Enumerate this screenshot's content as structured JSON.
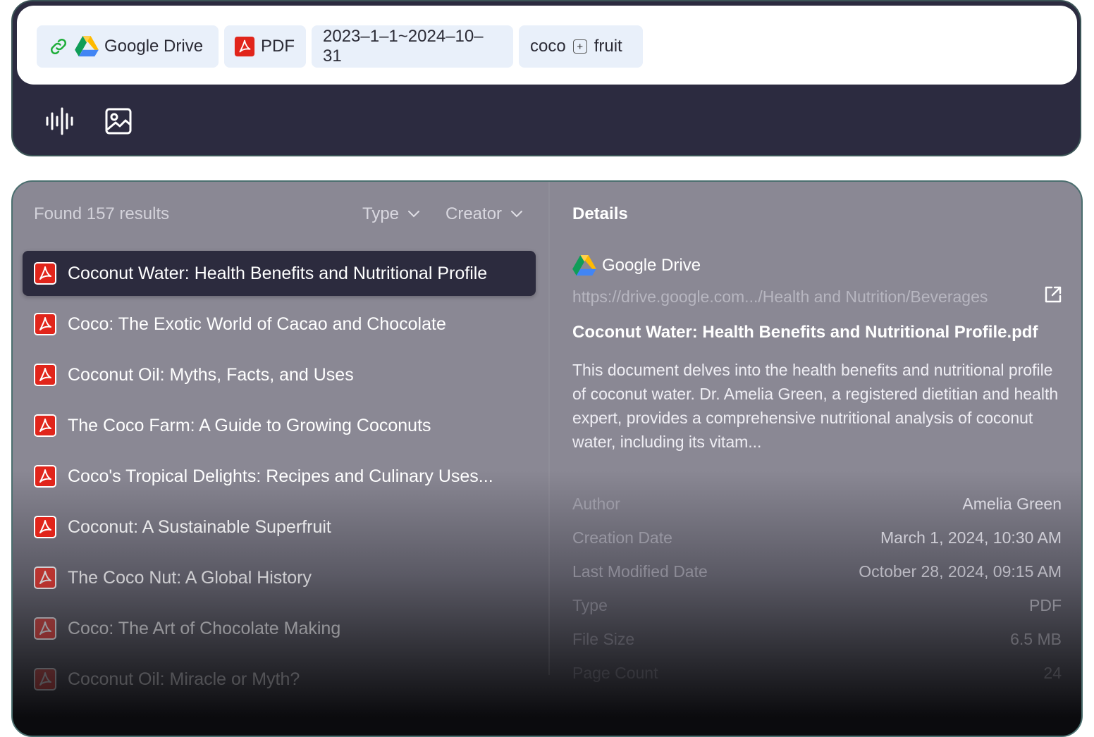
{
  "search": {
    "chips": {
      "source": "Google Drive",
      "filetype": "PDF",
      "date_range": "2023–1–1~2024–10–31",
      "keyword_1": "coco",
      "keyword_operator": "+",
      "keyword_2": "fruit"
    },
    "tools": [
      "voice-input",
      "image-input"
    ]
  },
  "results": {
    "count_text": "Found 157 results",
    "filters": {
      "type": "Type",
      "creator": "Creator"
    },
    "items": [
      {
        "title": "Coconut Water: Health Benefits and Nutritional Profile",
        "selected": true
      },
      {
        "title": "Coco: The Exotic World of Cacao and Chocolate"
      },
      {
        "title": "Coconut Oil: Myths, Facts, and Uses"
      },
      {
        "title": "The Coco Farm: A Guide to Growing Coconuts"
      },
      {
        "title": "Coco's Tropical Delights: Recipes and Culinary Uses..."
      },
      {
        "title": "Coconut: A Sustainable Superfruit"
      },
      {
        "title": "The Coco Nut: A Global History"
      },
      {
        "title": "Coco: The Art of Chocolate Making"
      },
      {
        "title": "Coconut Oil: Miracle or Myth?"
      }
    ]
  },
  "details": {
    "heading": "Details",
    "source": "Google Drive",
    "url": "https://drive.google.com.../Health and Nutrition/Beverages",
    "file_name": "Coconut Water: Health Benefits and Nutritional Profile.pdf",
    "summary": "This document delves into the health benefits and nutritional profile of coconut water. Dr. Amelia Green, a registered dietitian and health expert, provides a comprehensive nutritional analysis of coconut water, including its vitam...",
    "meta": [
      {
        "key": "Author",
        "value": "Amelia Green"
      },
      {
        "key": "Creation Date",
        "value": "March 1, 2024, 10:30 AM"
      },
      {
        "key": "Last Modified Date",
        "value": "October 28, 2024, 09:15 AM"
      },
      {
        "key": "Type",
        "value": "PDF"
      },
      {
        "key": "File Size",
        "value": "6.5 MB"
      },
      {
        "key": "Page Count",
        "value": "24"
      }
    ]
  },
  "colors": {
    "pdf_red": "#e1251b",
    "link_green": "#1fae3a",
    "panel_dark": "#2c2b40",
    "chip_bg": "#e9f0fa"
  }
}
